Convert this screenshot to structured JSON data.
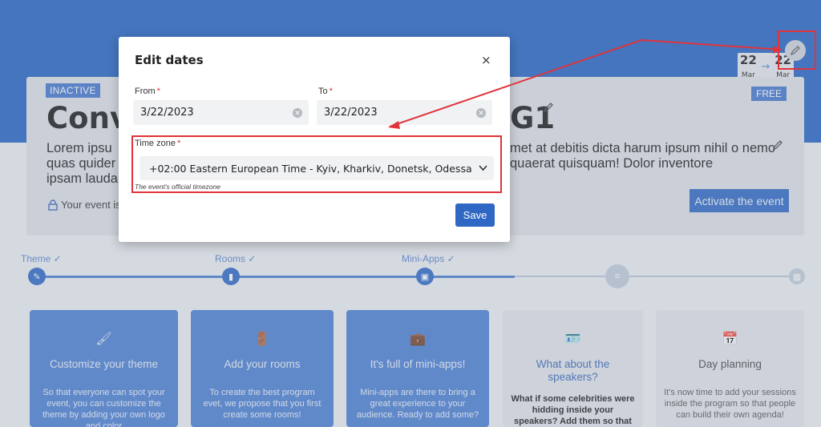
{
  "header": {
    "dates": {
      "start_day": "22",
      "start_month": "Mar",
      "end_day": "22",
      "end_month": "Mar",
      "arrow": "→"
    }
  },
  "event": {
    "status_badge": "INACTIVE",
    "plan_badge": "FREE",
    "title_left": "Conv",
    "title_right": "G1",
    "description_left": "Lorem ipsu quas quider ipsam lauda",
    "description_right": "met at debitis dicta harum ipsum nihil o nemo quaerat quisquam! Dolor inventore",
    "lock_text": "Your event is",
    "activate_label": "Activate the event"
  },
  "stepper": {
    "steps": [
      {
        "label": "Theme ✓"
      },
      {
        "label": "Rooms ✓"
      },
      {
        "label": "Mini-Apps ✓"
      }
    ]
  },
  "features": [
    {
      "title": "Customize your theme",
      "desc": "So that everyone can spot your event, you can customize the theme by adding your own logo and color"
    },
    {
      "title": "Add your rooms",
      "desc": "To create the best program evet, we propose that you first create some rooms!"
    },
    {
      "title": "It's full of mini-apps!",
      "desc": "Mini-apps are there to bring a great experience to your audience. Ready to add some?"
    },
    {
      "title": "What about the speakers?",
      "desc": "What if some celebrities were hidding inside your speakers? Add them so that your audience can see them!"
    },
    {
      "title": "Day planning",
      "desc": "It's now time to add your sessions inside the program so that people can build their own agenda!"
    }
  ],
  "modal": {
    "title": "Edit dates",
    "close": "×",
    "from_label": "From",
    "from_value": "3/22/2023",
    "to_label": "To",
    "to_value": "3/22/2023",
    "required_mark": "*",
    "timezone_label": "Time zone",
    "timezone_value": "+02:00 Eastern European Time - Kyiv, Kharkiv, Donetsk, Odessa",
    "timezone_help": "The event's official timezone",
    "save_label": "Save"
  },
  "colors": {
    "primary": "#2565c2",
    "annotation": "#e0343b"
  }
}
